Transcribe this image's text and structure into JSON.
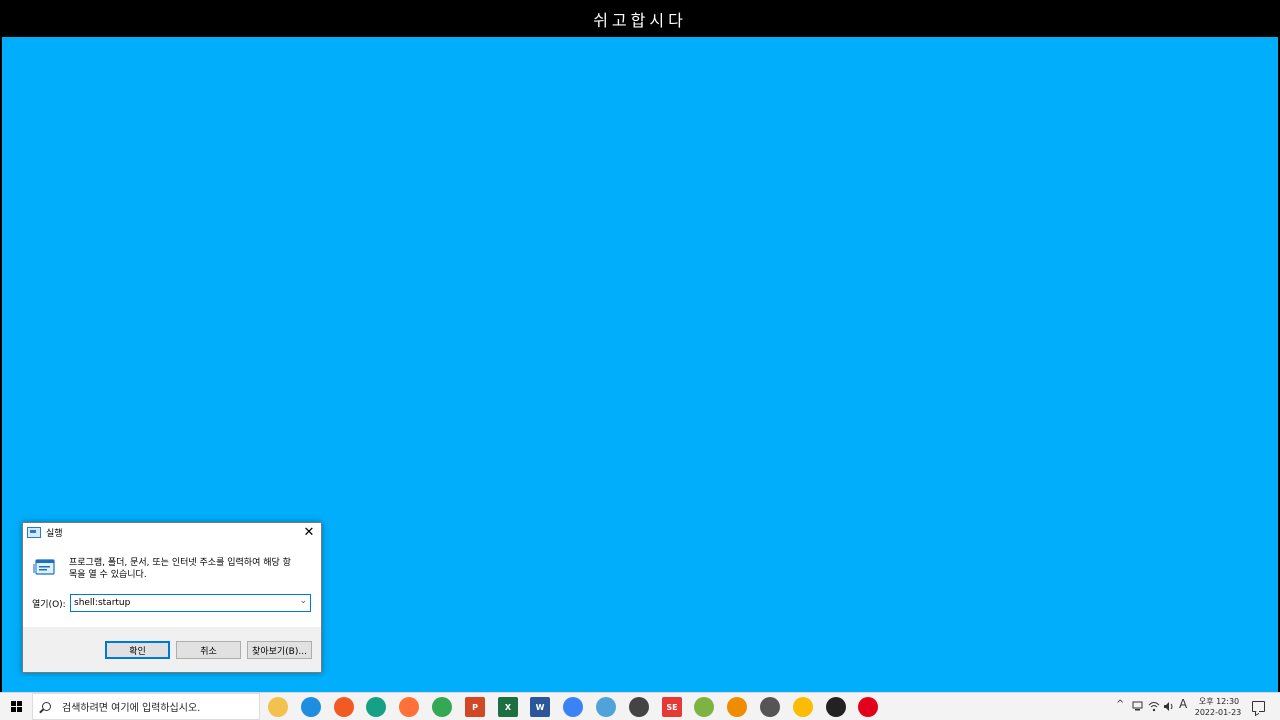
{
  "top_banner": {
    "text": "쉬고합시다"
  },
  "colors": {
    "desktop_background": "#01aefc",
    "top_banner_background": "#000000",
    "accent": "#0078d7"
  },
  "run_dialog": {
    "title": "실행",
    "close_glyph": "✕",
    "description_line1": "프로그램, 폴더, 문서, 또는 인터넷 주소를 입력하여 해당 항",
    "description_line2": "목을 열 수 있습니다.",
    "open_label": "열기(O):",
    "open_value": "shell:startup",
    "ok_label": "확인",
    "cancel_label": "취소",
    "browse_label": "찾아보기(B)..."
  },
  "taskbar": {
    "search_placeholder": "검색하려면 여기에 입력하십시오.",
    "apps": [
      {
        "icon": "file-explorer-icon",
        "glyph": "",
        "color": "#f2c14e"
      },
      {
        "icon": "edge-icon",
        "glyph": "",
        "color": "#1f8ee0"
      },
      {
        "icon": "brave-icon",
        "glyph": "",
        "color": "#f25a24"
      },
      {
        "icon": "app-swirl-icon",
        "glyph": "",
        "color": "#16a085"
      },
      {
        "icon": "firefox-icon",
        "glyph": "",
        "color": "#ff7139"
      },
      {
        "icon": "chrome-icon",
        "glyph": "",
        "color": "#34a853"
      },
      {
        "icon": "powerpoint-icon",
        "glyph": "P",
        "color": "#d24726"
      },
      {
        "icon": "excel-icon",
        "glyph": "X",
        "color": "#1d6f42"
      },
      {
        "icon": "word-icon",
        "glyph": "W",
        "color": "#2b579a"
      },
      {
        "icon": "notepad-app-icon",
        "glyph": "",
        "color": "#3b82f6"
      },
      {
        "icon": "remote-desktop-icon",
        "glyph": "",
        "color": "#4fa3d9"
      },
      {
        "icon": "magnifier-app-icon",
        "glyph": "",
        "color": "#444444"
      },
      {
        "icon": "se-app-icon",
        "glyph": "SE",
        "color": "#e53935"
      },
      {
        "icon": "green-app-icon",
        "glyph": "",
        "color": "#7cb342"
      },
      {
        "icon": "vlc-icon",
        "glyph": "",
        "color": "#f08c00"
      },
      {
        "icon": "calculator-icon",
        "glyph": "",
        "color": "#555555"
      },
      {
        "icon": "chrome-beta-icon",
        "glyph": "",
        "color": "#fbbc05"
      },
      {
        "icon": "sticky-notes-icon",
        "glyph": "",
        "color": "#222222"
      },
      {
        "icon": "opera-icon",
        "glyph": "",
        "color": "#e3001b"
      }
    ],
    "tray": {
      "chevron": "^",
      "input_indicator": "A",
      "time": "오후 12:30",
      "date": "2022-01-23"
    }
  }
}
